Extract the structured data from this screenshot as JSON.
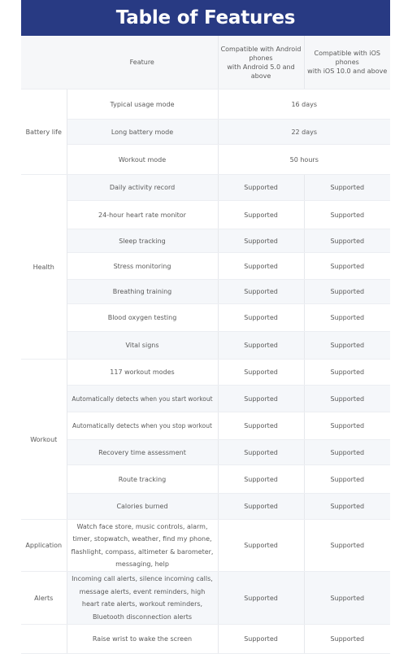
{
  "title": "Table of Features",
  "header": {
    "feature": "Feature",
    "android": "Compatible with Android phones with Android 5.0 and above",
    "android_lines": [
      "Compatible with Android",
      "phones",
      "with Android 5.0 and above"
    ],
    "ios_lines": [
      "Compatible with iOS",
      "phones",
      "with iOS 10.0 and above"
    ]
  },
  "groups": {
    "battery": {
      "label": "Battery life",
      "rows": [
        {
          "feature": "Typical usage mode",
          "value": "16 days"
        },
        {
          "feature": "Long battery mode",
          "value": "22 days"
        },
        {
          "feature": "Workout mode",
          "value": "50 hours"
        }
      ]
    },
    "health": {
      "label": "Health",
      "rows": [
        {
          "feature": "Daily activity record",
          "android": "Supported",
          "ios": "Supported"
        },
        {
          "feature": "24-hour heart rate monitor",
          "android": "Supported",
          "ios": "Supported"
        },
        {
          "feature": "Sleep tracking",
          "android": "Supported",
          "ios": "Supported"
        },
        {
          "feature": "Stress monitoring",
          "android": "Supported",
          "ios": "Supported"
        },
        {
          "feature": "Breathing training",
          "android": "Supported",
          "ios": "Supported"
        },
        {
          "feature": "Blood oxygen testing",
          "android": "Supported",
          "ios": "Supported"
        },
        {
          "feature": "Vital signs",
          "android": "Supported",
          "ios": "Supported"
        }
      ]
    },
    "workout": {
      "label": "Workout",
      "rows": [
        {
          "feature": "117 workout modes",
          "android": "Supported",
          "ios": "Supported"
        },
        {
          "feature": "Automatically detects when you start workout",
          "android": "Supported",
          "ios": "Supported"
        },
        {
          "feature": "Automatically detects when you stop workout",
          "android": "Supported",
          "ios": "Supported"
        },
        {
          "feature": "Recovery time assessment",
          "android": "Supported",
          "ios": "Supported"
        },
        {
          "feature": "Route tracking",
          "android": "Supported",
          "ios": "Supported"
        },
        {
          "feature": "Calories burned",
          "android": "Supported",
          "ios": "Supported"
        }
      ]
    },
    "application": {
      "label": "Application",
      "rows": [
        {
          "feature": "Watch face store, music controls, alarm, timer, stopwatch, weather, find my phone, flashlight, compass, altimeter & barometer, messaging, help",
          "android": "Supported",
          "ios": "Supported"
        }
      ]
    },
    "alerts": {
      "label": "Alerts",
      "rows": [
        {
          "feature": "Incoming call alerts, silence incoming calls, message alerts, event reminders, high heart rate alerts, workout reminders, Bluetooth disconnection alerts",
          "android": "Supported",
          "ios": "Supported"
        }
      ]
    },
    "other": {
      "label": "",
      "rows": [
        {
          "feature": "Raise wrist to wake the screen",
          "android": "Supported",
          "ios": "Supported"
        }
      ]
    }
  },
  "colors": {
    "banner": "#283a83",
    "banner_text": "#ffffff",
    "header_bg": "#f6f7f9",
    "shaded_row": "#f5f7fa"
  }
}
